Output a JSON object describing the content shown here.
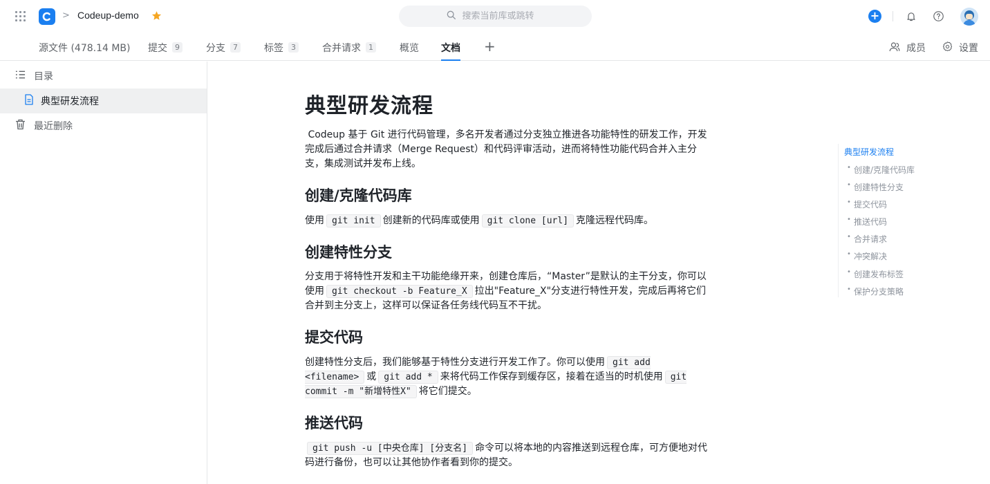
{
  "header": {
    "repo_name": "Codeup-demo",
    "breadcrumb_sep": ">",
    "search_placeholder": "搜索当前库或跳转",
    "plus_label": "+"
  },
  "tabs": [
    {
      "label": "源文件 (478.14 MB)",
      "count": ""
    },
    {
      "label": "提交",
      "count": "9"
    },
    {
      "label": "分支",
      "count": "7"
    },
    {
      "label": "标签",
      "count": "3"
    },
    {
      "label": "合并请求",
      "count": "1"
    },
    {
      "label": "概览",
      "count": ""
    },
    {
      "label": "文档",
      "count": "",
      "active": true
    }
  ],
  "tab_add": "+",
  "right_actions": {
    "members": "成员",
    "settings": "设置"
  },
  "sidebar": {
    "toc_label": "目录",
    "doc_item": "典型研发流程",
    "trash_label": "最近删除"
  },
  "doc": {
    "title": "典型研发流程",
    "intro": "Codeup 基于 Git 进行代码管理，多名开发者通过分支独立推进各功能特性的研发工作，开发完成后通过合并请求（Merge Request）和代码评审活动，进而将特性功能代码合并入主分支，集成测试并发布上线。",
    "sections": [
      {
        "heading": "创建/克隆代码库",
        "t1": "使用",
        "c1": "git init",
        "t2": "创建新的代码库或使用",
        "c2": "git clone [url]",
        "t3": "克隆远程代码库。"
      },
      {
        "heading": "创建特性分支",
        "t1": "分支用于将特性开发和主干功能绝缘开来，创建仓库后，“Master”是默认的主干分支，你可以使用",
        "c1": "git checkout -b Feature_X",
        "t2": "拉出\"Feature_X\"分支进行特性开发，完成后再将它们合并到主分支上，这样可以保证各任务线代码互不干扰。"
      },
      {
        "heading": "提交代码",
        "t1": "创建特性分支后，我们能够基于特性分支进行开发工作了。你可以使用",
        "c1": "git add <filename>",
        "t2": "或",
        "c2": "git add *",
        "t3": "来将代码工作保存到缓存区，接着在适当的时机使用",
        "c3": "git commit -m \"新增特性X\"",
        "t4": "将它们提交。"
      },
      {
        "heading": "推送代码",
        "c1": "git push -u [中央仓库] [分支名]",
        "t1": "命令可以将本地的内容推送到远程仓库，可方便地对代码进行备份，也可以让其他协作者看到你的提交。"
      }
    ]
  },
  "outline": {
    "title": "典型研发流程",
    "items": [
      "创建/克隆代码库",
      "创建特性分支",
      "提交代码",
      "推送代码",
      "合并请求",
      "冲突解决",
      "创建发布标签",
      "保护分支策略"
    ]
  }
}
